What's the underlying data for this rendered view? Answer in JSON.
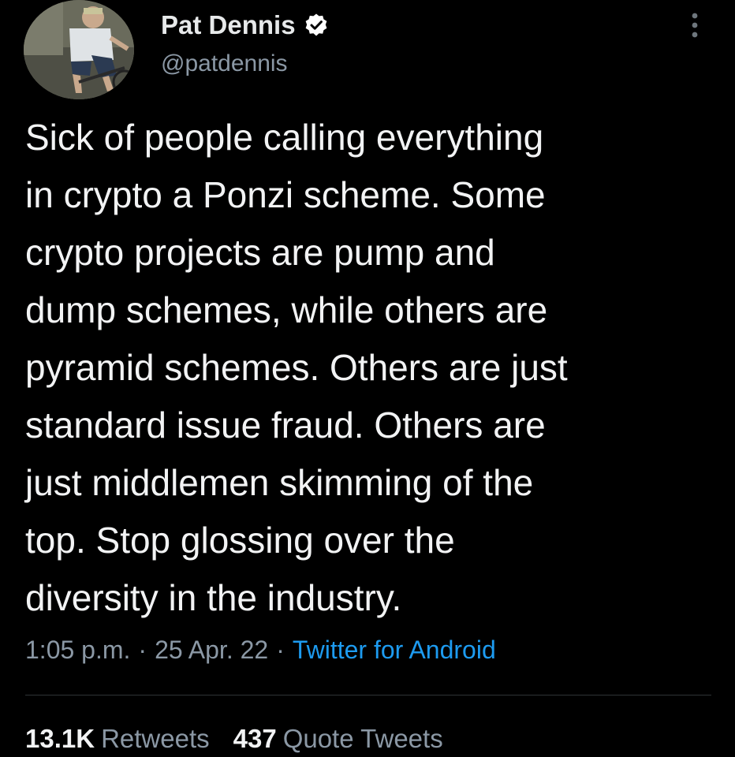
{
  "author": {
    "display_name": "Pat Dennis",
    "handle": "@patdennis",
    "verified": true
  },
  "tweet": {
    "lines": [
      "Sick of people calling everything",
      "in crypto a Ponzi scheme. Some",
      "crypto projects are pump and",
      "dump schemes, while others are",
      "pyramid schemes. Others are just",
      "standard issue fraud. Others are",
      "just middlemen skimming of the",
      "top. Stop glossing over the",
      "diversity in the industry."
    ],
    "time": "1:05 p.m.",
    "date": "25 Apr. 22",
    "separator": "·",
    "source": "Twitter for Android"
  },
  "stats": {
    "retweets_count": "13.1K",
    "retweets_label": "Retweets",
    "quotes_count": "437",
    "quotes_label": "Quote Tweets"
  },
  "colors": {
    "background": "#000000",
    "text": "#e7e9ea",
    "secondary": "#8b98a5",
    "link": "#1d9bf0",
    "verified_badge": "#ffffff"
  },
  "icons": {
    "verified": "verified-badge-icon",
    "more": "more-vertical-icon"
  }
}
